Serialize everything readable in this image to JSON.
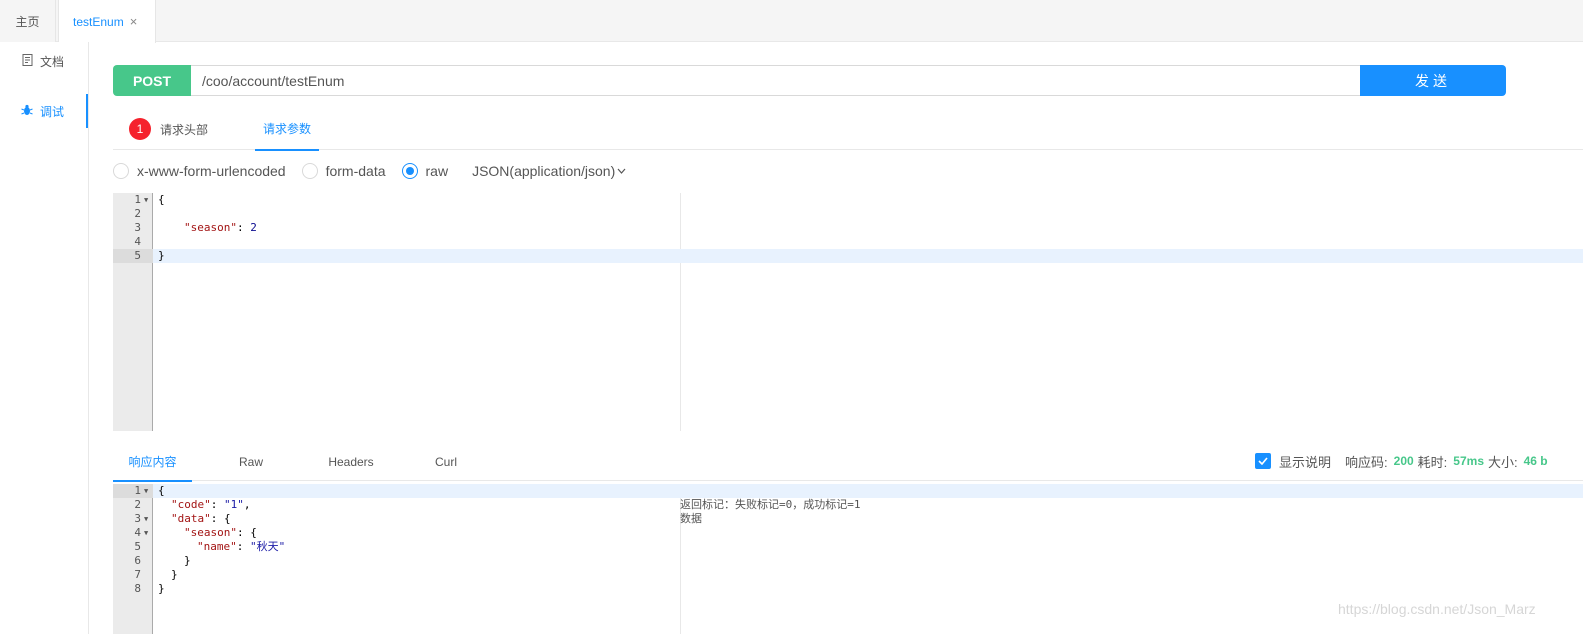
{
  "tabs": {
    "home": "主页",
    "current": "testEnum",
    "close_glyph": "×"
  },
  "sidebar": {
    "items": [
      {
        "label": "文档",
        "icon": "document-icon"
      },
      {
        "label": "调试",
        "icon": "bug-icon",
        "active": true
      }
    ]
  },
  "request": {
    "method": "POST",
    "url": "/coo/account/testEnum",
    "send_label": "发送",
    "tabs": {
      "headers_label": "请求头部",
      "headers_count": "1",
      "params_label": "请求参数"
    },
    "body_types": [
      "x-www-form-urlencoded",
      "form-data",
      "raw"
    ],
    "selected_body_type": "raw",
    "content_type": "JSON(application/json)",
    "line_numbers": [
      "1",
      "2",
      "3",
      "4",
      "5"
    ],
    "body_lines": {
      "l1": "{",
      "l3_key": "\"season\"",
      "l3_sep": ": ",
      "l3_val": "2",
      "l5": "}"
    }
  },
  "response": {
    "tabs": [
      "响应内容",
      "Raw",
      "Headers",
      "Curl"
    ],
    "show_description_label": "显示说明",
    "show_description_checked": true,
    "status_label": "响应码:",
    "status_value": "200",
    "time_label": "耗时:",
    "time_value": "57ms",
    "size_label": "大小:",
    "size_value": "46 b",
    "line_numbers": [
      "1",
      "2",
      "3",
      "4",
      "5",
      "6",
      "7",
      "8"
    ],
    "body_lines": {
      "l1": "{",
      "l2_key": "\"code\"",
      "l2_val": "\"1\"",
      "l3_key": "\"data\"",
      "l3_rest": ": {",
      "l4_key": "\"season\"",
      "l4_rest": ": {",
      "l5_key": "\"name\"",
      "l5_val": "\"秋天\"",
      "l6": "}",
      "l7": "}",
      "l8": "}"
    },
    "comments": {
      "code": "返回标记：失败标记=0，成功标记=1",
      "data": "数据"
    }
  },
  "watermark": "https://blog.csdn.net/Json_Marz"
}
